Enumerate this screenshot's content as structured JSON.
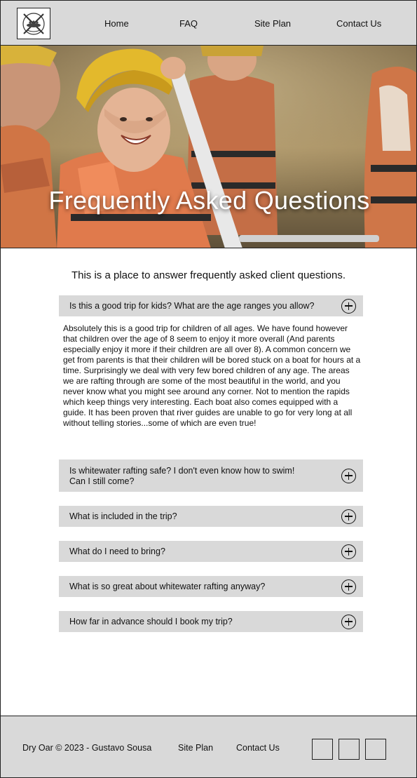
{
  "header": {
    "logo_alt": "Dry Oar Rafting logo",
    "nav": [
      "Home",
      "FAQ",
      "Site Plan",
      "Contact Us"
    ]
  },
  "hero": {
    "title": "Frequently Asked Questions"
  },
  "main": {
    "intro": "This is a place to answer frequently asked client questions.",
    "faqs": [
      {
        "question": "Is this a good trip for kids? What are the age ranges you allow?",
        "answer": "Absolutely this is a good trip for children of all ages. We have found however that children over the age of 8 seem to enjoy it more overall (And parents especially enjoy it more if their children are all over 8). A common concern we get from parents is that their children will be bored stuck on a boat for hours at a time. Surprisingly we deal with very few bored children of any age. The areas we are rafting through are some of the most beautiful in the world, and you never know what you might see around any corner. Not to mention the rapids which keep things very interesting. Each boat also comes equipped with a guide. It has been proven that river guides are unable to go for very long at all without telling stories...some of which are even true!",
        "expanded": true
      },
      {
        "question_line1": "Is whitewater rafting safe? I don't even know how to swim!",
        "question_line2": "Can I still come?"
      },
      {
        "question": "What is included in the trip?"
      },
      {
        "question": "What do I need to bring?"
      },
      {
        "question": "What is so great about whitewater rafting anyway?"
      },
      {
        "question": "How far in advance should I book my trip?"
      }
    ],
    "toggle_icon": "plus-circle-icon"
  },
  "footer": {
    "copyright": "Dry Oar © 2023 - Gustavo Sousa",
    "links": [
      "Site Plan",
      "Contact Us"
    ],
    "social_icons": [
      "social-icon-1",
      "social-icon-2",
      "social-icon-3"
    ]
  },
  "colors": {
    "panel_gray": "#d9d9d9",
    "border": "#222222",
    "text": "#111111",
    "hero_title": "#ffffff"
  }
}
